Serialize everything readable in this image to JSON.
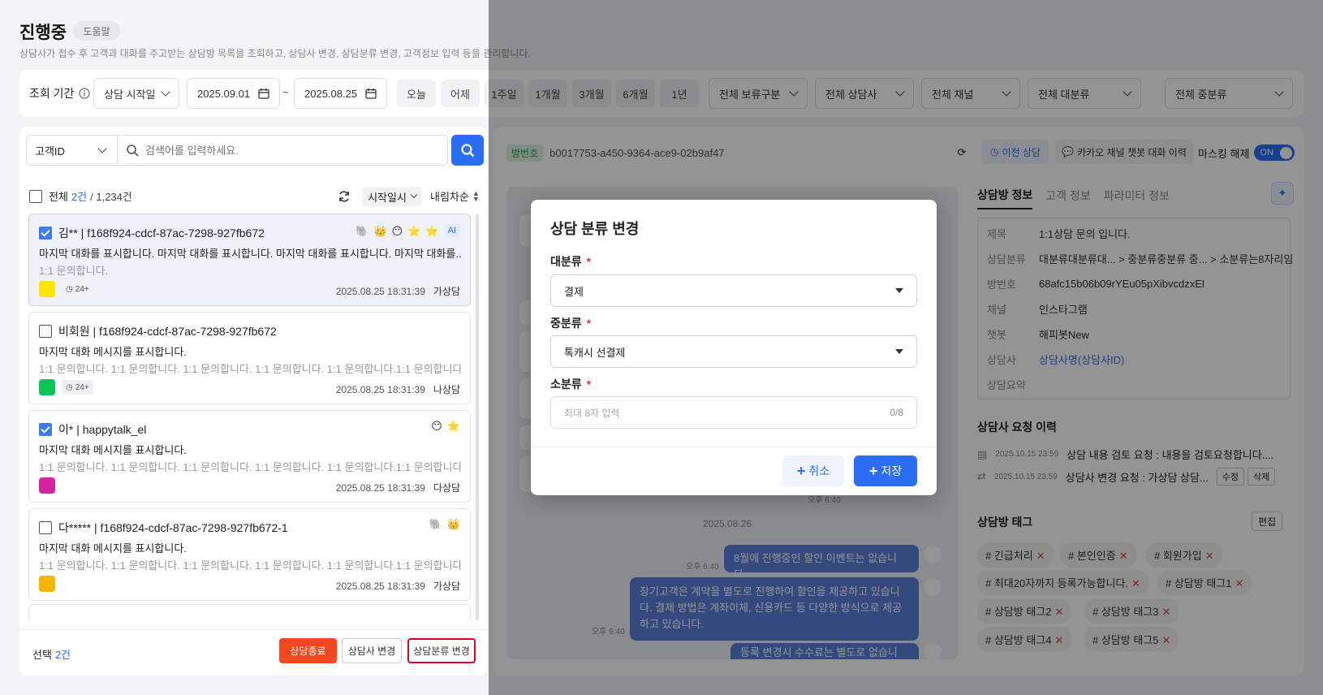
{
  "header": {
    "title": "진행중",
    "help": "도움말",
    "description": "상담사가 접수 후 고객과 대화를 주고받는 상담방 목록을 조회하고, 상담사 변경, 상담분류 변경, 고객정보 입력 등을 관리합니다."
  },
  "filter": {
    "period_label": "조회 기간",
    "period_type": "상담 시작일",
    "date_from": "2025.09.01",
    "tilde": "~",
    "date_to": "2025.08.25",
    "quick": [
      "오늘",
      "어제",
      "1주일",
      "1개월",
      "3개월",
      "6개월",
      "1년"
    ],
    "selects": [
      "전체 보류구분",
      "전체 상담사",
      "전체 채널",
      "전체 대분류",
      "전체 중분류"
    ]
  },
  "search": {
    "type": "고객ID",
    "placeholder": "검색어를 입력하세요."
  },
  "list": {
    "all_label": "전체",
    "count": "2건",
    "total": "/ 1,234건",
    "sort_field": "시작일시",
    "sort_order": "내림차순",
    "items": [
      {
        "name": "김** | f168f924-cdcf-87ac-7298-927fb672",
        "msg": "마지막 대화를 표시합니다.  마지막 대화를 표시합니다. 마지막 대화를 표시합니다. 마지막 대화를...",
        "sub": "1:1 문의합니다.",
        "date": "2025.08.25 18:31:39",
        "agent": "가상담",
        "badge": "24+",
        "channel": "kakao",
        "channel_color": "#fee500",
        "ai": "AI",
        "icons": [
          "🐘",
          "👑",
          "😶",
          "⭐",
          "⭐"
        ],
        "checked": true
      },
      {
        "name": "비회원 | f168f924-cdcf-87ac-7298-927fb672",
        "msg": "마지막 대화 메시지를 표시합니다.",
        "sub": "1:1 문의합니다. 1:1 문의합니다. 1:1 문의합니다. 1:1 문의합니다. 1:1 문의합니다.1:1 문의합니다.1:1...",
        "date": "2025.08.25 18:31:39",
        "agent": "나상담",
        "badge": "24+",
        "channel": "line",
        "channel_color": "#06c755",
        "checked": false
      },
      {
        "name": "이* | happytalk_el",
        "msg": "마지막 대화 메시지를 표시합니다.",
        "sub": "1:1 문의합니다. 1:1 문의합니다. 1:1 문의합니다. 1:1 문의합니다. 1:1 문의합니다.1:1 문의합니다.1:1...",
        "date": "2025.08.25 18:31:39",
        "agent": "다상담",
        "channel": "instagram",
        "channel_color": "#d6249f",
        "icons": [
          "😶",
          "⭐"
        ],
        "checked": true
      },
      {
        "name": "다***** | f168f924-cdcf-87ac-7298-927fb672-1",
        "msg": "마지막 대화 메시지를 표시합니다.",
        "sub": "1:1 문의합니다. 1:1 문의합니다. 1:1 문의합니다. 1:1 문의합니다. 1:1 문의합니다.1:1 문의합니다.1:1...",
        "date": "2025.08.25 18:31:39",
        "agent": "가상담",
        "channel": "happytalk",
        "channel_color": "#f5b400",
        "icons": [
          "🐘",
          "👑"
        ],
        "checked": false
      }
    ]
  },
  "bottom": {
    "selected_label": "선택",
    "selected_count": "2건",
    "end_btn": "상담종료",
    "agent_btn": "상담사 변경",
    "class_btn": "상담분류 변경"
  },
  "room": {
    "id_label": "방번호",
    "id": "b0017753-a450-9364-ace9-02b9af47",
    "prev": "이전 상담",
    "kakao_history": "카카오 채널 챗봇 대화 이력",
    "masking": "마스킹 해제",
    "toggle": "ON",
    "date_sep": "2025.08.26",
    "bubbles": [
      {
        "text": "8월에 진행중인 할인 이벤트는 없습니다.",
        "time": "오후 6:40"
      },
      {
        "text": "장기고객은 계약을 별도로 진행하여 할인을 제공하고 있습니다. 결제 방법은 계좌이체, 신용카드 등 다양한 방식으로 제공하고 있습니다.",
        "time": "오후 6:40"
      },
      {
        "text": "등록 변경시 수수료는 별도로 없습니다.",
        "time": ""
      }
    ],
    "bubble_left_time": "오후 6:40"
  },
  "info": {
    "tabs": [
      "상담방 정보",
      "고객 정보",
      "파라미터 정보"
    ],
    "rows": [
      {
        "k": "제목",
        "v": "1:1상담 문의 입니다."
      },
      {
        "k": "상담분류",
        "v": "대분류대분류대... > 중분류중분류 중... > 소분류는8자리임"
      },
      {
        "k": "방번호",
        "v": "68afc15b06b09rYEu05pXibvcdzxEl"
      },
      {
        "k": "채널",
        "v": "인스타그램"
      },
      {
        "k": "챗봇",
        "v": "해피봇New"
      },
      {
        "k": "상담사",
        "v": "상담사명(상담사ID)"
      },
      {
        "k": "상담요약",
        "v": ""
      }
    ],
    "req_title": "상담사 요청 이력",
    "requests": [
      {
        "date": "2025.10.15 23:59",
        "text": "상담 내용 검토 요청 : 내용을 검토요청합니다...."
      },
      {
        "date": "2025.10.15 23:59",
        "text": "상담사 변경 요청 : 가상담 상담...",
        "edit": "수정",
        "del": "삭제"
      }
    ],
    "tag_title": "상담방 태그",
    "tag_edit": "편집",
    "tags": [
      "# 긴급처리",
      "# 본인인증",
      "# 회원가입",
      "# 최대20자까지 등록가능합니다.",
      "# 상담방 태그1",
      "# 상담방 태그2",
      "# 상담방 태그3",
      "# 상담방 태그4",
      "# 상담방 태그5"
    ]
  },
  "modal": {
    "title": "상담 분류 변경",
    "l1_label": "대분류",
    "l1_value": "결제",
    "l2_label": "중분류",
    "l2_value": "톡캐시 선결제",
    "l3_label": "소분류",
    "l3_placeholder": "최대 8자 입력",
    "l3_count": "0/8",
    "required": "*",
    "cancel": "취소",
    "save": "저장"
  }
}
